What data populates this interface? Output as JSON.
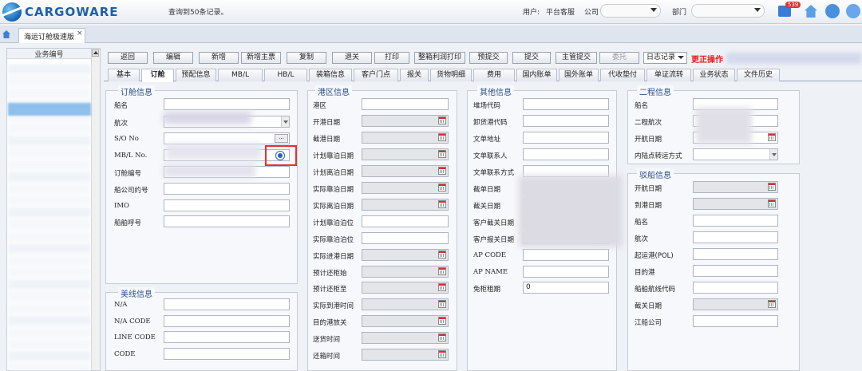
{
  "app": {
    "logo": "CARGOWARE",
    "record_count": "查询到50条记录。"
  },
  "header": {
    "user_label": "用户:",
    "user_value": "平台客服",
    "company_label": "公司",
    "dept_label": "部门",
    "mail_badge": "539"
  },
  "page_tab": {
    "title": "海运订舱极速版",
    "close": "×"
  },
  "sidebar": {
    "header": "业务编号"
  },
  "toolbar": {
    "buttons": [
      "返回",
      "编辑",
      "新增",
      "新增主票",
      "复制",
      "退关",
      "打印",
      "整箱利润打印",
      "预提交",
      "提交",
      "主管提交",
      "委托"
    ],
    "log_select": "日志记录",
    "correct_op": "更正操作"
  },
  "form_tabs": [
    "基本",
    "订舱",
    "预配信息",
    "MB/L",
    "HB/L",
    "装箱信息",
    "客户门点",
    "报关",
    "货物明细",
    "费用",
    "国内账单",
    "国外账单",
    "代收垫付",
    "单证流转",
    "业务状态",
    "文件历史"
  ],
  "booking": {
    "title": "订舱信息",
    "labels": [
      "船名",
      "航次",
      "S/O No",
      "MB/L No.",
      "订舱编号",
      "船公司约号",
      "IMO",
      "船舶呼号"
    ]
  },
  "route": {
    "title": "美线信息",
    "labels": [
      "N/A",
      "N/A CODE",
      "LINE CODE",
      "CODE"
    ]
  },
  "port": {
    "title": "港区信息",
    "labels": [
      "港区",
      "开港日期",
      "截港日期",
      "计划靠泊日期",
      "计划离泊日期",
      "实际靠泊日期",
      "实际离泊日期",
      "计划靠泊泊位",
      "实际靠泊泊位",
      "实际进港日期",
      "预计还柜始",
      "预计还柜至",
      "实际到港时间",
      "目的港放关",
      "送货时间",
      "还箱时间"
    ]
  },
  "other": {
    "title": "其他信息",
    "labels": [
      "堆场代码",
      "卸货港代码",
      "文单地址",
      "文单联系人",
      "文单联系方式",
      "截单日期",
      "截关日期",
      "客户截关日期",
      "客户报关日期",
      "AP CODE",
      "AP NAME",
      "免柜租期"
    ],
    "free_days_value": "0"
  },
  "second_leg": {
    "title": "二程信息",
    "labels": [
      "船名",
      "二程航次",
      "开航日期",
      "内陆点转运方式"
    ]
  },
  "vessel": {
    "title": "驳船信息",
    "labels": [
      "开航日期",
      "到港日期",
      "船名",
      "航次",
      "起运港(POL)",
      "目的港",
      "船舶航线代码",
      "截关日期",
      "江船公司"
    ]
  },
  "colors": {
    "accent": "#1f5fa8",
    "highlight": "#e53030",
    "correct_op": "#e02020"
  }
}
